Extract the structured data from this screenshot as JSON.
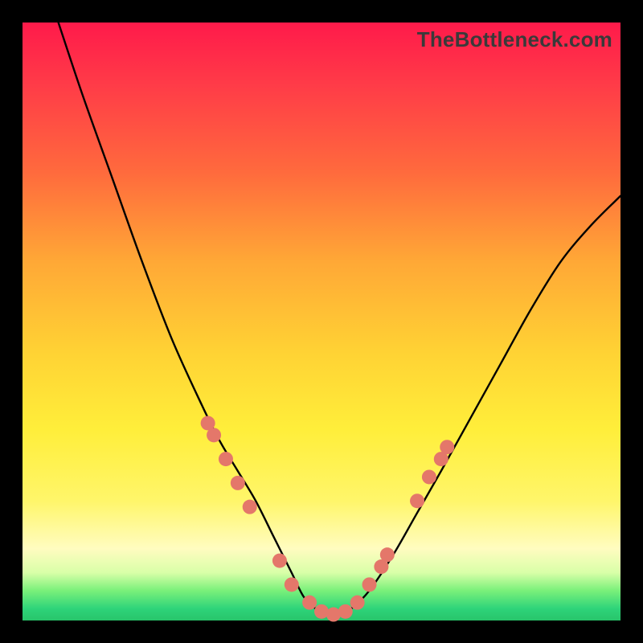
{
  "attribution": "TheBottleneck.com",
  "chart_data": {
    "type": "line",
    "title": "",
    "xlabel": "",
    "ylabel": "",
    "xlim": [
      0,
      100
    ],
    "ylim": [
      0,
      100
    ],
    "legend": false,
    "grid": false,
    "series": [
      {
        "name": "bottleneck-curve",
        "x": [
          6,
          10,
          15,
          20,
          25,
          30,
          33,
          36,
          39,
          42,
          45,
          47,
          49,
          51,
          53,
          55,
          58,
          62,
          66,
          70,
          75,
          80,
          85,
          90,
          95,
          100
        ],
        "values": [
          100,
          88,
          74,
          60,
          47,
          36,
          30,
          25,
          20,
          14,
          8,
          4,
          2,
          1,
          1,
          2,
          5,
          11,
          18,
          25,
          34,
          43,
          52,
          60,
          66,
          71
        ]
      }
    ],
    "markers": {
      "name": "highlight-dots",
      "color": "#e4776a",
      "points": [
        {
          "x": 31,
          "y": 33
        },
        {
          "x": 32,
          "y": 31
        },
        {
          "x": 34,
          "y": 27
        },
        {
          "x": 36,
          "y": 23
        },
        {
          "x": 38,
          "y": 19
        },
        {
          "x": 43,
          "y": 10
        },
        {
          "x": 45,
          "y": 6
        },
        {
          "x": 48,
          "y": 3
        },
        {
          "x": 50,
          "y": 1.5
        },
        {
          "x": 52,
          "y": 1
        },
        {
          "x": 54,
          "y": 1.5
        },
        {
          "x": 56,
          "y": 3
        },
        {
          "x": 58,
          "y": 6
        },
        {
          "x": 60,
          "y": 9
        },
        {
          "x": 61,
          "y": 11
        },
        {
          "x": 66,
          "y": 20
        },
        {
          "x": 68,
          "y": 24
        },
        {
          "x": 70,
          "y": 27
        },
        {
          "x": 71,
          "y": 29
        }
      ]
    }
  }
}
